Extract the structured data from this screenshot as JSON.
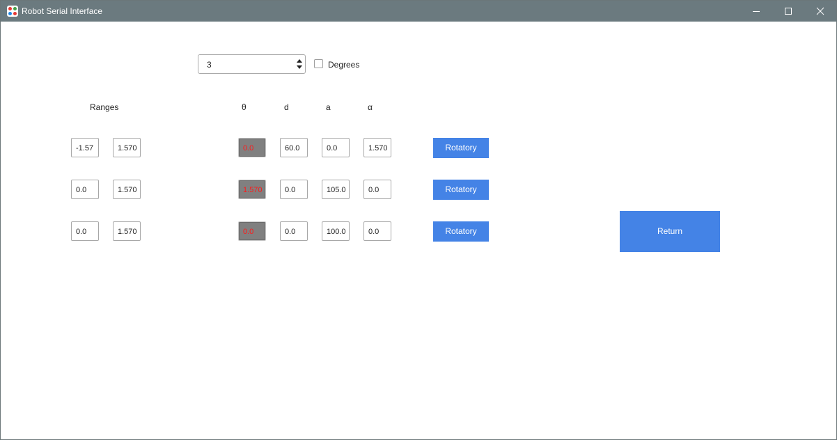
{
  "window": {
    "title": "Robot Serial Interface",
    "controls": [
      "minimize-icon",
      "maximize-icon",
      "close-icon"
    ]
  },
  "dof": {
    "value": "3",
    "degrees_label": "Degrees",
    "degrees_checked": false
  },
  "headers": {
    "ranges": "Ranges",
    "theta": "θ",
    "d": "d",
    "a": "a",
    "alpha": "α"
  },
  "rows": [
    {
      "range_min": "-1.57",
      "range_max": "1.570",
      "theta": "0.0",
      "d": "60.0",
      "a": "0.0",
      "alpha": "1.570",
      "joint_button": "Rotatory"
    },
    {
      "range_min": "0.0",
      "range_max": "1.570",
      "theta": "1.570",
      "d": "0.0",
      "a": "105.0",
      "alpha": "0.0",
      "joint_button": "Rotatory"
    },
    {
      "range_min": "0.0",
      "range_max": "1.570",
      "theta": "0.0",
      "d": "0.0",
      "a": "100.0",
      "alpha": "0.0",
      "joint_button": "Rotatory"
    }
  ],
  "return_label": "Return",
  "colors": {
    "titlebar": "#6b7a7f",
    "accent_button": "#4483e6",
    "theta_field_bg": "#808080",
    "theta_text": "#ff1a1a"
  }
}
